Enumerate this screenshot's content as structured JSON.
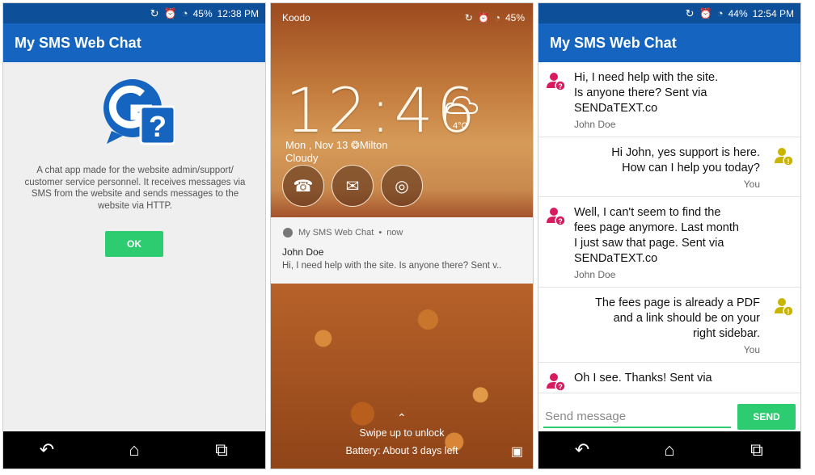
{
  "screen1": {
    "status": {
      "battery": "45%",
      "time": "12:38 PM"
    },
    "app_title": "My SMS Web Chat",
    "about_text": "A chat app made for the website admin/support/ customer service personnel.  It receives messages via SMS from the website and sends messages to the website via HTTP.",
    "ok_label": "OK"
  },
  "screen2": {
    "carrier": "Koodo",
    "battery": "45%",
    "clock": "12:46",
    "temperature": "4°C",
    "date_location": "Mon , Nov 13  ❂Milton",
    "weather_desc": "Cloudy",
    "notification": {
      "app_name": "My SMS Web Chat",
      "time": "now",
      "title": "John Doe",
      "body": "Hi, I need help with the site.  Is anyone there? Sent v.."
    },
    "unlock_hint": "Swipe up to unlock",
    "battery_hint": "Battery: About 3 days left"
  },
  "screen3": {
    "status": {
      "battery": "44%",
      "time": "12:54 PM"
    },
    "app_title": "My SMS Web Chat",
    "messages": [
      {
        "side": "left",
        "text_lines": [
          "Hi, I need help with the site.",
          "Is anyone there? Sent via",
          "SENDaTEXT.co"
        ],
        "sender": "John Doe"
      },
      {
        "side": "right",
        "text_lines": [
          "Hi John, yes support is here.",
          "How can I help you today?"
        ],
        "sender": "You"
      },
      {
        "side": "left",
        "text_lines": [
          "Well, I can't seem to find the",
          "fees page anymore.  Last month",
          "I just saw that page. Sent via",
          "SENDaTEXT.co"
        ],
        "sender": "John Doe"
      },
      {
        "side": "right",
        "text_lines": [
          "The fees page is already a PDF",
          "and a link should be on your",
          "right sidebar."
        ],
        "sender": "You"
      },
      {
        "side": "left",
        "text_lines": [
          "Oh I see.  Thanks! Sent via"
        ],
        "sender": ""
      }
    ],
    "input_placeholder": "Send message",
    "send_label": "SEND"
  },
  "colors": {
    "app_bar": "#1565c0",
    "status_bar": "#0d4f98",
    "accent_green": "#2ecc71",
    "avatar_customer": "#d81b60",
    "avatar_agent": "#c9b400"
  },
  "icons": [
    "back-icon",
    "home-icon",
    "recents-icon",
    "wifi-icon",
    "alarm-icon",
    "sync-icon",
    "phone-icon",
    "chat-icon",
    "globe-icon",
    "camera-icon",
    "cloud-icon"
  ]
}
